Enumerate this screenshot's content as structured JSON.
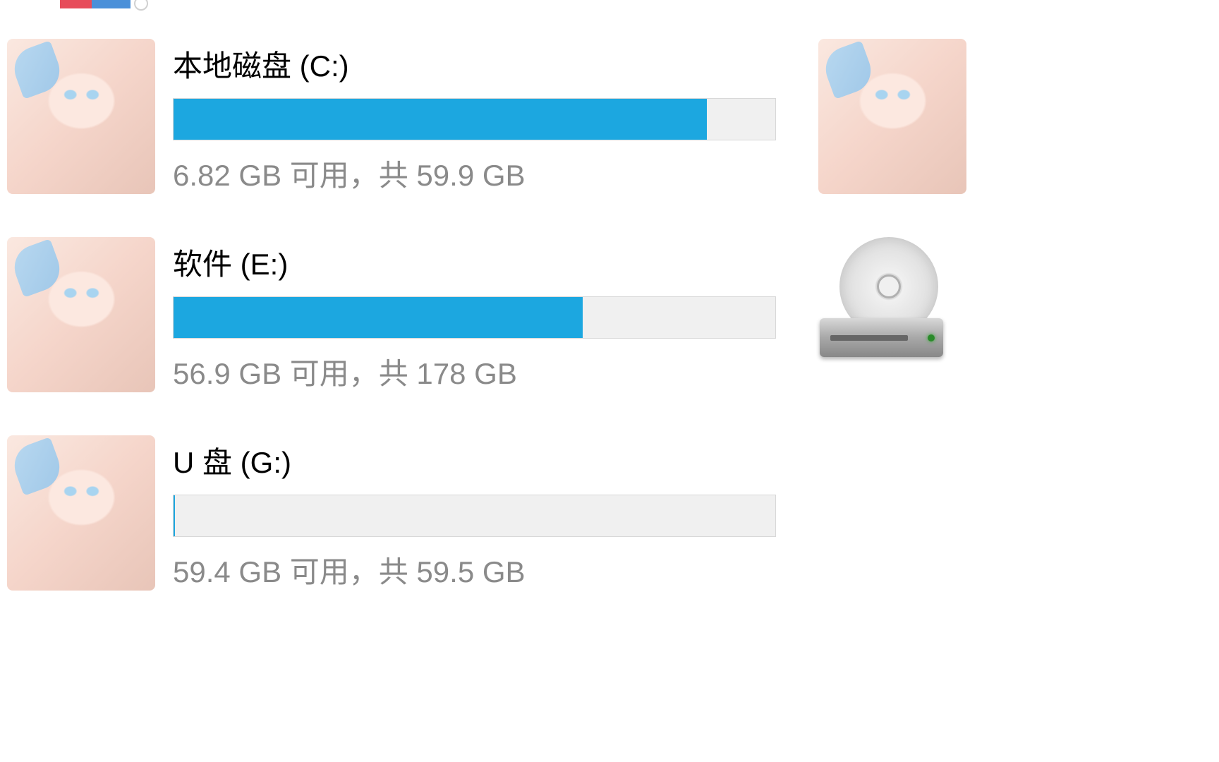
{
  "drives": [
    {
      "name": "本地磁盘 (C:)",
      "free": "6.82 GB",
      "total": "59.9 GB",
      "status": "6.82 GB 可用，共 59.9 GB",
      "usedPercent": 88.6,
      "rightIcon": "anime"
    },
    {
      "name": "软件 (E:)",
      "free": "56.9 GB",
      "total": "178 GB",
      "status": "56.9 GB 可用，共 178 GB",
      "usedPercent": 68.0,
      "rightIcon": "disk"
    },
    {
      "name": "U 盘 (G:)",
      "free": "59.4 GB",
      "total": "59.5 GB",
      "status": "59.4 GB 可用，共 59.5 GB",
      "usedPercent": 0.2,
      "rightIcon": null
    }
  ],
  "colors": {
    "progressFill": "#1ca7e0",
    "progressBg": "#f0f0f0",
    "textPrimary": "#000000",
    "textSecondary": "#8a8a8a"
  }
}
